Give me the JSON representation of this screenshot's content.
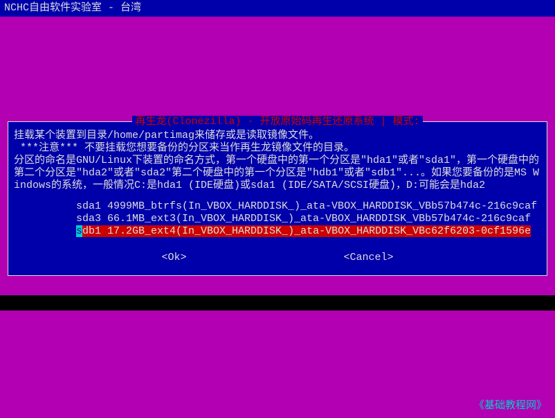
{
  "title_bar": "NCHC自由软件实验室 - 台湾",
  "dialog": {
    "header": "再生龙(Clonezilla) - 开放原始码再生还原系统 | 模式:",
    "instructions": "挂载某个装置到目录/home/partimag来储存或是读取镜像文件。\n ***注意*** 不要挂载您想要备份的分区来当作再生龙镜像文件的目录。\n分区的命名是GNU/Linux下装置的命名方式，第一个硬盘中的第一个分区是\"hda1\"或者\"sda1\"，第一个硬盘中的第二个分区是\"hda2\"或者\"sda2\"第二个硬盘中的第一个分区是\"hdb1\"或者\"sdb1\"...。如果您要备份的是MS Windows的系统，一般情况C:是hda1 (IDE硬盘)或sda1 (IDE/SATA/SCSI硬盘)，D:可能会是hda2",
    "partitions": [
      {
        "label": "sda1 4999MB_btrfs(In_VBOX_HARDDISK_)_ata-VBOX_HARDDISK_VBb57b474c-216c9caf",
        "selected": false
      },
      {
        "label": "sda3 66.1MB_ext3(In_VBOX_HARDDISK_)_ata-VBOX_HARDDISK_VBb57b474c-216c9caf",
        "selected": false
      },
      {
        "label": "sdb1 17.2GB_ext4(In_VBOX_HARDDISK_)_ata-VBOX_HARDDISK_VBc62f6203-0cf1596e",
        "selected": true
      }
    ],
    "buttons": {
      "ok": "<Ok>",
      "cancel": "<Cancel>"
    }
  },
  "watermark": "《基础教程网》"
}
